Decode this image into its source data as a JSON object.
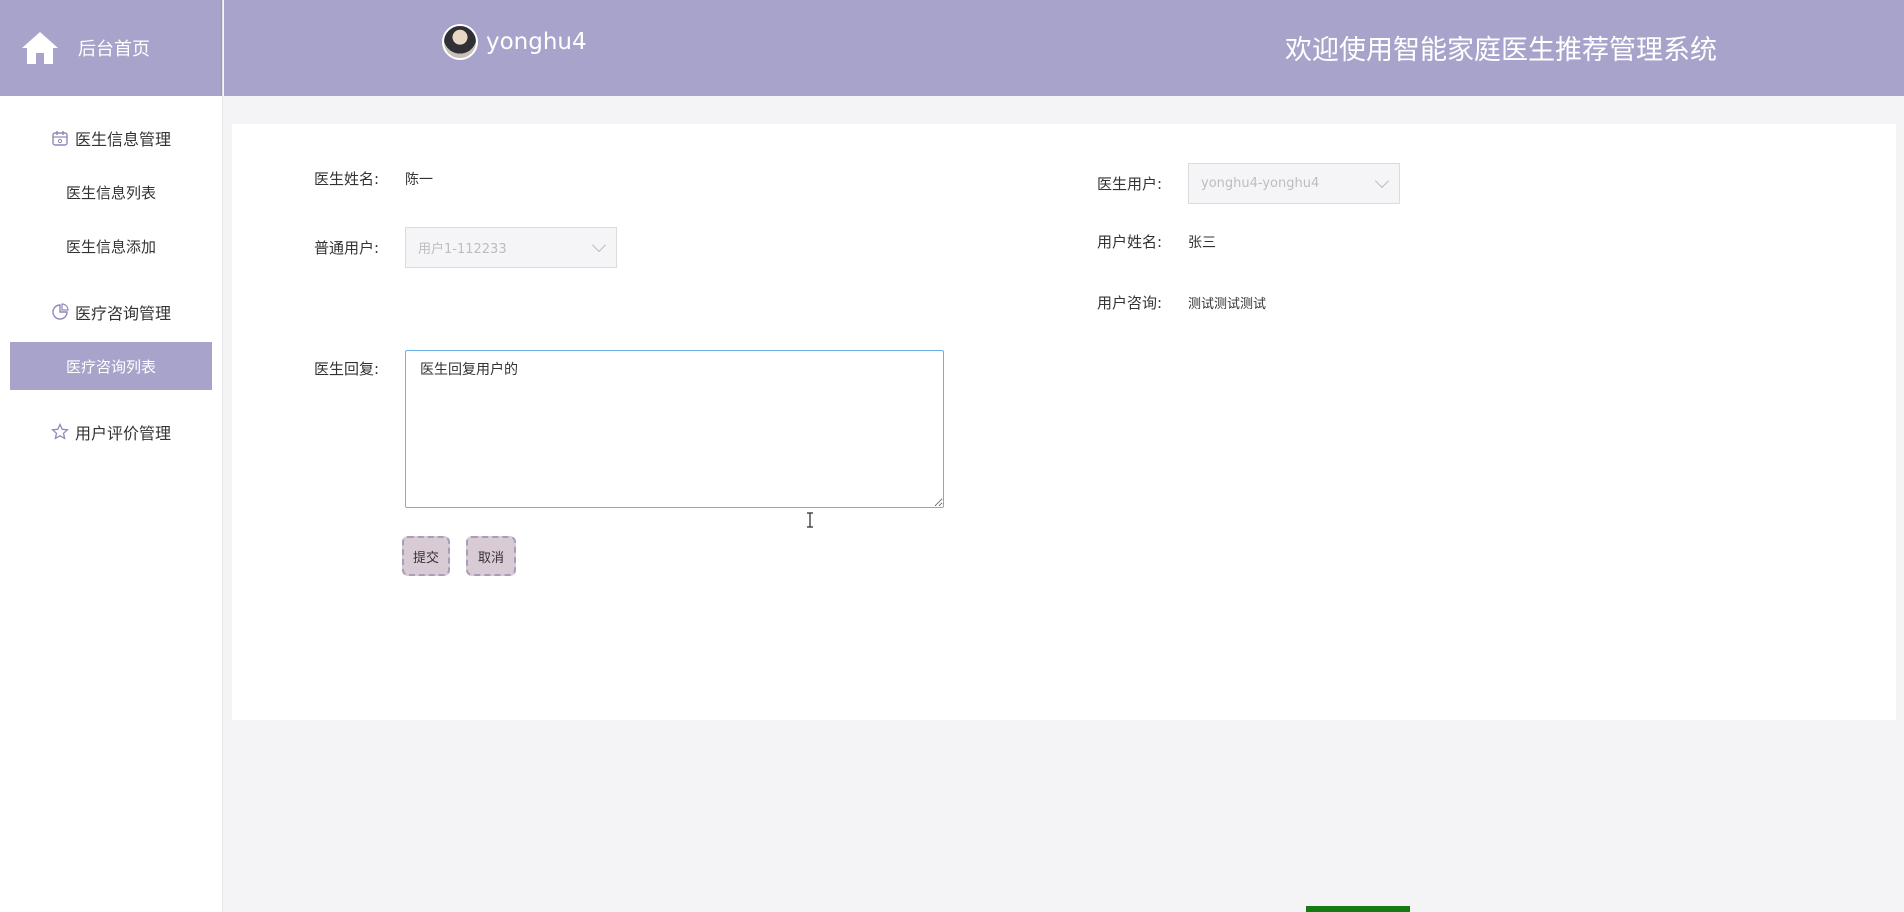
{
  "sidebar": {
    "home_label": "后台首页",
    "groups": [
      {
        "label": "医生信息管理",
        "icon": "calendar-icon",
        "items": [
          "医生信息列表",
          "医生信息添加"
        ]
      },
      {
        "label": "医疗咨询管理",
        "icon": "pie-icon",
        "items": [
          "医疗咨询列表"
        ]
      },
      {
        "label": "用户评价管理",
        "icon": "star-icon",
        "items": []
      }
    ],
    "active_item": "医疗咨询列表"
  },
  "header": {
    "username": "yonghu4",
    "title": "欢迎使用智能家庭医生推荐管理系统"
  },
  "form": {
    "doctor_name": {
      "label": "医生姓名:",
      "value": "陈一"
    },
    "doctor_user": {
      "label": "医生用户:",
      "value": "yonghu4-yonghu4"
    },
    "normal_user": {
      "label": "普通用户:",
      "value": "用户1-112233"
    },
    "user_name": {
      "label": "用户姓名:",
      "value": "张三"
    },
    "user_consult": {
      "label": "用户咨询:",
      "value": "测试测试测试"
    },
    "doctor_reply": {
      "label": "医生回复:",
      "value": "医生回复用户的"
    },
    "submit_label": "提交",
    "cancel_label": "取消"
  },
  "colors": {
    "accent": "#a8a3cb",
    "button": "#d9cbd6",
    "focus": "#6cb1e8"
  }
}
